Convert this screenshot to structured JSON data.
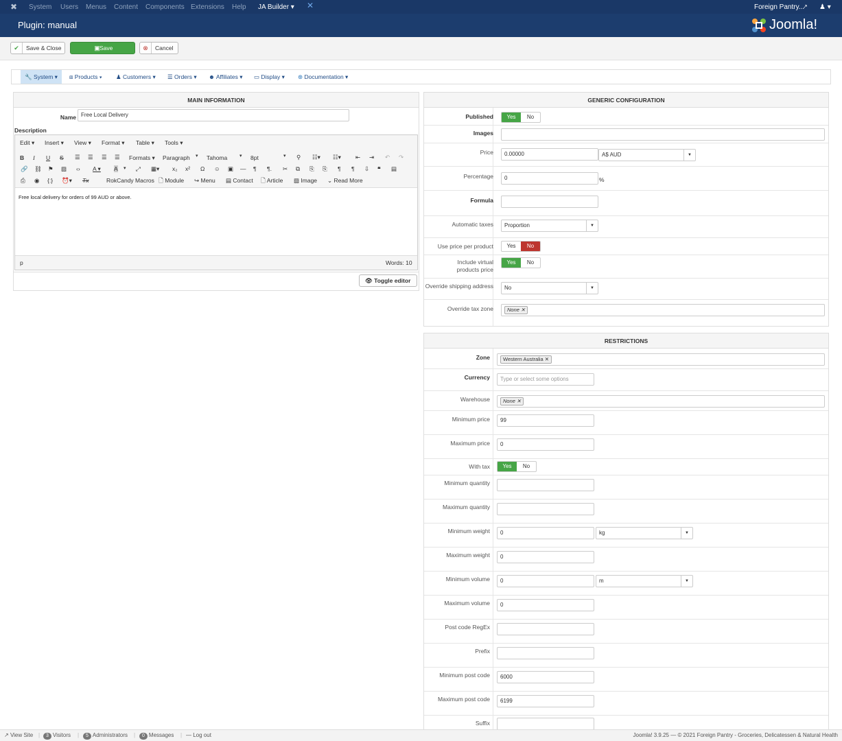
{
  "topnav": {
    "items": [
      "System",
      "Users",
      "Menus",
      "Content",
      "Components",
      "Extensions",
      "Help"
    ],
    "ja_builder": "JA Builder ▾",
    "user_site": "Foreign Pantry...",
    "user_icon": "user-icon"
  },
  "header": {
    "title": "Plugin: manual",
    "logo": "Joomla!"
  },
  "toolbar": {
    "save_close": "Save & Close",
    "save": "Save",
    "cancel": "Cancel"
  },
  "hkmenu": [
    "System ▾",
    "Products ▾",
    "Customers ▾",
    "Orders ▾",
    "Affiliates ▾",
    "Display ▾",
    "Documentation ▾"
  ],
  "main_info": {
    "heading": "MAIN INFORMATION",
    "name_label": "Name",
    "name_value": "Free Local Delivery",
    "description_label": "Description",
    "editor_menu": [
      "Edit ▾",
      "Insert ▾",
      "View ▾",
      "Format ▾",
      "Table ▾",
      "Tools ▾"
    ],
    "tb_formats": "Formats ▾",
    "tb_paragraph": "Paragraph",
    "tb_font": "Tahoma",
    "tb_size": "8pt",
    "tb_rokcandy": "RokCandy Macros",
    "tb_module": "Module",
    "tb_menu": "Menu",
    "tb_contact": "Contact",
    "tb_article": "Article",
    "tb_image": "Image",
    "tb_readmore": "Read More",
    "content": "Free local delivery for orders of 99 AUD or above.",
    "path": "p",
    "words": "Words: 10",
    "toggle": "Toggle editor"
  },
  "generic": {
    "heading": "GENERIC CONFIGURATION",
    "published": "Published",
    "images": "Images",
    "price": "Price",
    "price_value": "0.00000",
    "currency": "A$ AUD",
    "percentage": "Percentage",
    "percentage_value": "0",
    "percent_sign": "%",
    "formula": "Formula",
    "auto_taxes": "Automatic taxes",
    "auto_taxes_value": "Proportion",
    "use_price": "Use price per product",
    "include_virtual": "Include virtual",
    "include_virtual2": "products price",
    "override_ship": "Override shipping address",
    "override_ship_value": "No",
    "override_tax": "Override tax zone",
    "override_tax_value": "None",
    "yes": "Yes",
    "no": "No"
  },
  "restrictions": {
    "heading": "RESTRICTIONS",
    "zone": "Zone",
    "zone_value": "Western Australia",
    "currency": "Currency",
    "currency_ph": "Type or select some options",
    "warehouse": "Warehouse",
    "warehouse_value": "None",
    "min_price": "Minimum price",
    "min_price_value": "99",
    "max_price": "Maximum price",
    "max_price_value": "0",
    "with_tax": "With tax",
    "min_qty": "Minimum quantity",
    "max_qty": "Maximum quantity",
    "min_weight": "Minimum weight",
    "min_weight_value": "0",
    "weight_unit": "kg",
    "max_weight": "Maximum weight",
    "max_weight_value": "0",
    "min_volume": "Minimum volume",
    "min_volume_value": "0",
    "volume_unit": "m",
    "max_volume": "Maximum volume",
    "max_volume_value": "0",
    "postcode_regex": "Post code RegEx",
    "prefix": "Prefix",
    "min_postcode": "Minimum post code",
    "min_postcode_value": "6000",
    "max_postcode": "Maximum post code",
    "max_postcode_value": "6199",
    "suffix": "Suffix"
  },
  "status": {
    "view_site": "View Site",
    "visitors_count": "3",
    "visitors": "Visitors",
    "admins_count": "5",
    "admins": "Administrators",
    "messages_count": "0",
    "messages": "Messages",
    "logout": "Log out",
    "footer": "Joomla! 3.9.25 — © 2021 Foreign Pantry - Groceries, Delicatessen & Natural Health"
  }
}
